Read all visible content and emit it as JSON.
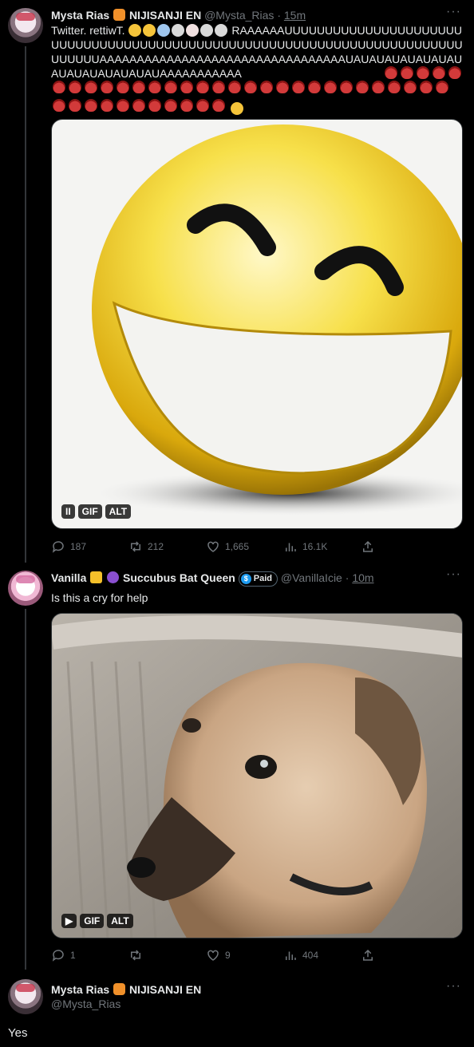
{
  "tweet1": {
    "display_name": "Mysta Rias",
    "affiliation": "NIJISANJI EN",
    "handle": "@Mysta_Rias",
    "time": "15m",
    "text_lead": "Twitter. rettiwT.",
    "text_body": "RAAAAAAUUUUUUUUUUUUUUUUUUUUUUUUUUUUUUUUUUUUUUUUUUUUUUUUUUUUUUUUUUUUUUUUUUUUUUUUUUUUUUUAAAAAAAAAAAAAAAAAAAAAAAAAAAAAAAAAUAUAUAUAUAUAUAUAUAUAUAUAUAUAUAAAAAAAAAAA",
    "media_badges": [
      "GIF",
      "ALT"
    ],
    "replies": "187",
    "retweets": "212",
    "likes": "1,665",
    "views": "16.1K"
  },
  "tweet2": {
    "display_name": "Vanilla",
    "title": "Succubus Bat Queen",
    "paid_label": "Paid",
    "handle": "@VanillaIcie",
    "time": "10m",
    "text": "Is this a cry for help",
    "media_badges": [
      "GIF",
      "ALT"
    ],
    "replies": "1",
    "retweets": "",
    "likes": "9",
    "views": "404"
  },
  "tweet3": {
    "display_name": "Mysta Rias",
    "affiliation": "NIJISANJI EN",
    "handle": "@Mysta_Rias",
    "text": "Yes"
  },
  "icons": [
    "reply-icon",
    "retweet-icon",
    "like-icon",
    "views-icon",
    "share-icon",
    "more-icon",
    "pause-icon",
    "play-icon",
    "devil-emoji",
    "fox-emoji",
    "crown-emoji",
    "imp-emoji",
    "paid-badge-icon"
  ],
  "colors": {
    "background": "#000000",
    "text": "#e7e9ea",
    "muted": "#71767b",
    "divider": "#2f3336",
    "accent": "#1d9bf0"
  }
}
